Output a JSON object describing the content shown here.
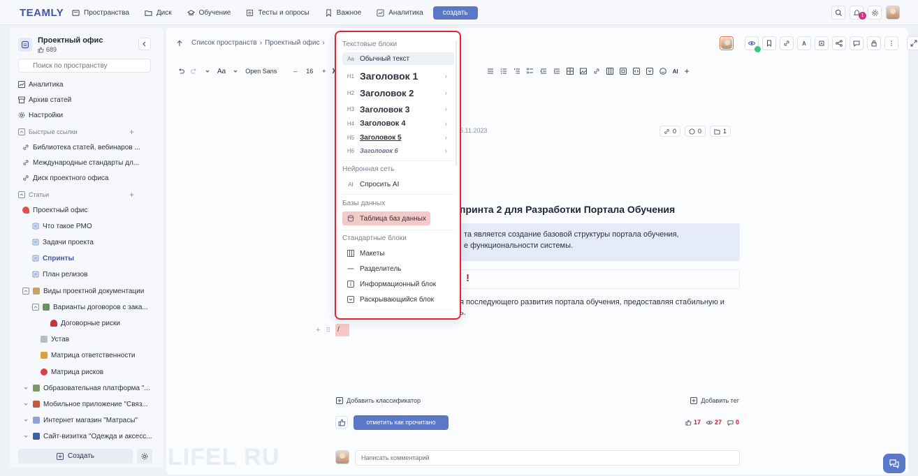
{
  "topbar": {
    "logo": "TEAMLY",
    "nav": [
      {
        "label": "Пространства",
        "icon": "spaces-icon"
      },
      {
        "label": "Диск",
        "icon": "folder-icon"
      },
      {
        "label": "Обучение",
        "icon": "graduation-icon"
      },
      {
        "label": "Тесты и опросы",
        "icon": "list-icon"
      },
      {
        "label": "Важное",
        "icon": "bookmark-icon"
      },
      {
        "label": "Аналитика",
        "icon": "chart-icon"
      }
    ],
    "create_label": "создать",
    "notification_count": "1"
  },
  "sidebar": {
    "space_title": "Проектный офис",
    "space_likes": "689",
    "search_placeholder": "Поиск по пространству",
    "items": [
      {
        "label": "Аналитика"
      },
      {
        "label": "Архив статей"
      },
      {
        "label": "Настройки"
      }
    ],
    "quick_links_title": "Быстрые ссылки",
    "quick_links": [
      {
        "label": "Библиотека статей, вебинаров ..."
      },
      {
        "label": "Международные стандарты дл..."
      },
      {
        "label": "Диск проектного офиса"
      }
    ],
    "articles_title": "Статьи",
    "articles": [
      {
        "label": "Проектный офис"
      },
      {
        "label": "Что такое PMO"
      },
      {
        "label": "Задачи проекта"
      },
      {
        "label": "Спринты"
      },
      {
        "label": "План релизов"
      },
      {
        "label": "Виды проектной документации"
      },
      {
        "label": "Варианты договоров с зака..."
      },
      {
        "label": "Договорные риски"
      },
      {
        "label": "Устав"
      },
      {
        "label": "Матрица ответственности"
      },
      {
        "label": "Матрица рисков"
      },
      {
        "label": "Образовательная платформа \"..."
      },
      {
        "label": "Мобильное приложение \"Связ..."
      },
      {
        "label": "Интернет магазин \"Матрасы\""
      },
      {
        "label": "Сайт-визитка \"Одежда и аксесс..."
      }
    ],
    "create_label": "Создать"
  },
  "main": {
    "breadcrumb": [
      "Список пространств",
      "Проектный офис"
    ],
    "toolbar": {
      "font": "Open Sans",
      "font_size": "16",
      "bold": "Ж",
      "ai": "AI"
    },
    "date": "5.11.2023",
    "stats": {
      "links": "0",
      "comments": "0",
      "files": "1"
    },
    "title": "принта 2 для Разработки Портала Обучения",
    "callout_lines": [
      "та является создание базовой структуры портала обучения,",
      "е функциональности системы."
    ],
    "box_mark": "!",
    "paragraph_lines": [
      "я последующего развития портала обучения, предоставляя стабильную и",
      "ь."
    ],
    "slash": "/",
    "add_classifier": "Добавить классификатор",
    "add_tag": "Добавить тег",
    "mark_read": "отметить как прочитано",
    "reactions": {
      "likes": "17",
      "views": "27",
      "comments": "0"
    },
    "comment_placeholder": "Написать комментарий",
    "right_tool_a": "A"
  },
  "menu": {
    "text_blocks_title": "Текстовые блоки",
    "text_blocks": [
      {
        "icon_text": "Aa",
        "label": "Обычный текст"
      },
      {
        "icon_text": "H1",
        "label": "Заголовок 1"
      },
      {
        "icon_text": "H2",
        "label": "Заголовок 2"
      },
      {
        "icon_text": "H3",
        "label": "Заголовок 3"
      },
      {
        "icon_text": "H4",
        "label": "Заголовок 4"
      },
      {
        "icon_text": "H5",
        "label": "Заголовок 5"
      },
      {
        "icon_text": "H6",
        "label": "Заголовок 6"
      }
    ],
    "neural_title": "Нейронная сеть",
    "neural": {
      "icon_text": "AI",
      "label": "Спросить AI"
    },
    "db_title": "Базы данных",
    "db": {
      "label": "Таблица баз данных"
    },
    "standard_title": "Стандартные блоки",
    "standard": [
      {
        "label": "Макеты"
      },
      {
        "label": "Разделитель"
      },
      {
        "label": "Информационный блок"
      },
      {
        "label": "Раскрывающийся блок"
      }
    ]
  },
  "watermark": "LIFEL RU",
  "colors": {
    "accent": "#5b78c7",
    "highlight_red": "#e3232f",
    "db_highlight": "#f6c9c9",
    "callout": "#e6ebf8"
  }
}
